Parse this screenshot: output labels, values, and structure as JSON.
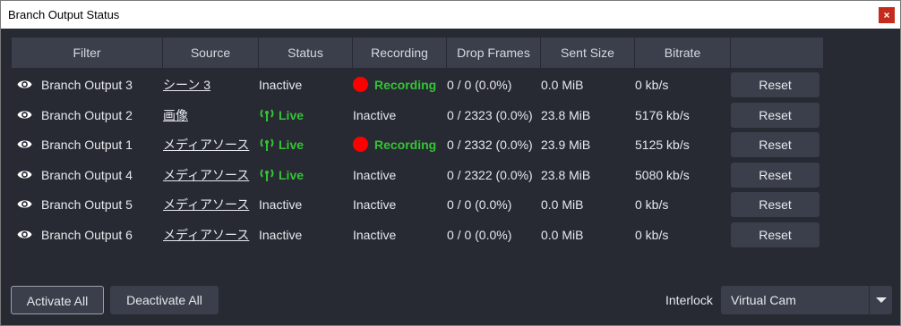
{
  "window": {
    "title": "Branch Output Status",
    "close_label": "×"
  },
  "table": {
    "headers": [
      "Filter",
      "Source",
      "Status",
      "Recording",
      "Drop Frames",
      "Sent Size",
      "Bitrate",
      ""
    ],
    "rows": [
      {
        "filter": "Branch Output 3",
        "source": "シーン 3",
        "status": "Inactive",
        "status_live": false,
        "recording": "Recording",
        "recording_active": true,
        "drop_frames": "0 / 0 (0.0%)",
        "sent_size": "0.0 MiB",
        "bitrate": "0 kb/s",
        "reset": "Reset"
      },
      {
        "filter": "Branch Output 2",
        "source": "画像",
        "status": "Live",
        "status_live": true,
        "recording": "Inactive",
        "recording_active": false,
        "drop_frames": "0 / 2323 (0.0%)",
        "sent_size": "23.8 MiB",
        "bitrate": "5176 kb/s",
        "reset": "Reset"
      },
      {
        "filter": "Branch Output 1",
        "source": "メディアソース",
        "status": "Live",
        "status_live": true,
        "recording": "Recording",
        "recording_active": true,
        "drop_frames": "0 / 2332 (0.0%)",
        "sent_size": "23.9 MiB",
        "bitrate": "5125 kb/s",
        "reset": "Reset"
      },
      {
        "filter": "Branch Output 4",
        "source": "メディアソース",
        "status": "Live",
        "status_live": true,
        "recording": "Inactive",
        "recording_active": false,
        "drop_frames": "0 / 2322 (0.0%)",
        "sent_size": "23.8 MiB",
        "bitrate": "5080 kb/s",
        "reset": "Reset"
      },
      {
        "filter": "Branch Output 5",
        "source": "メディアソース",
        "status": "Inactive",
        "status_live": false,
        "recording": "Inactive",
        "recording_active": false,
        "drop_frames": "0 / 0 (0.0%)",
        "sent_size": "0.0 MiB",
        "bitrate": "0 kb/s",
        "reset": "Reset"
      },
      {
        "filter": "Branch Output 6",
        "source": "メディアソース",
        "status": "Inactive",
        "status_live": false,
        "recording": "Inactive",
        "recording_active": false,
        "drop_frames": "0 / 0 (0.0%)",
        "sent_size": "0.0 MiB",
        "bitrate": "0 kb/s",
        "reset": "Reset"
      }
    ]
  },
  "footer": {
    "activate_all": "Activate All",
    "deactivate_all": "Deactivate All",
    "interlock_label": "Interlock",
    "interlock_value": "Virtual Cam"
  },
  "colors": {
    "background": "#272a33",
    "panel": "#3b3f4b",
    "live_green": "#35c335",
    "recording_dot": "#ff0000",
    "close_red": "#c42b1c"
  },
  "icons": {
    "visibility": "eye-icon",
    "live": "antenna-icon",
    "recording": "record-dot-icon",
    "dropdown": "chevron-down-icon",
    "close": "close-icon"
  }
}
